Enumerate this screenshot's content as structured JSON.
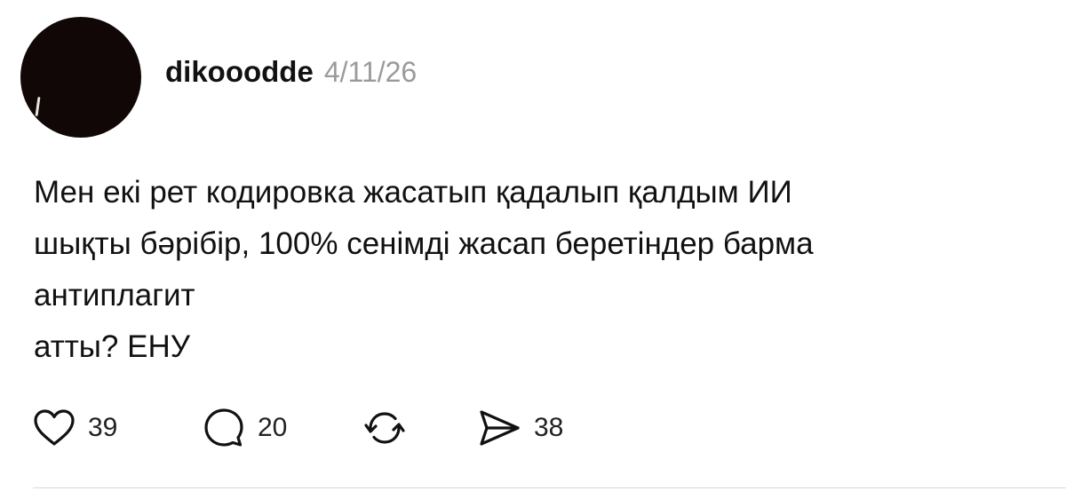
{
  "post": {
    "username": "dikooodde",
    "date": "4/11/26",
    "text_lines": [
      "Мен екі рет кодировка жасатып қадалып қалдым ИИ",
      "шықты бәрібір, 100% сенімді жасап беретіндер барма",
      "антиплагит",
      "атты? ЕНУ"
    ]
  },
  "actions": {
    "like": {
      "icon": "heart-icon",
      "count": "39"
    },
    "comment": {
      "icon": "comment-bubble-icon",
      "count": "20"
    },
    "repost": {
      "icon": "repost-arrows-icon"
    },
    "share": {
      "icon": "send-paper-plane-icon",
      "count": "38"
    }
  },
  "colors": {
    "text": "#111111",
    "muted": "#9a9a9a",
    "avatar": "#120707",
    "divider": "#d9d9d9"
  }
}
